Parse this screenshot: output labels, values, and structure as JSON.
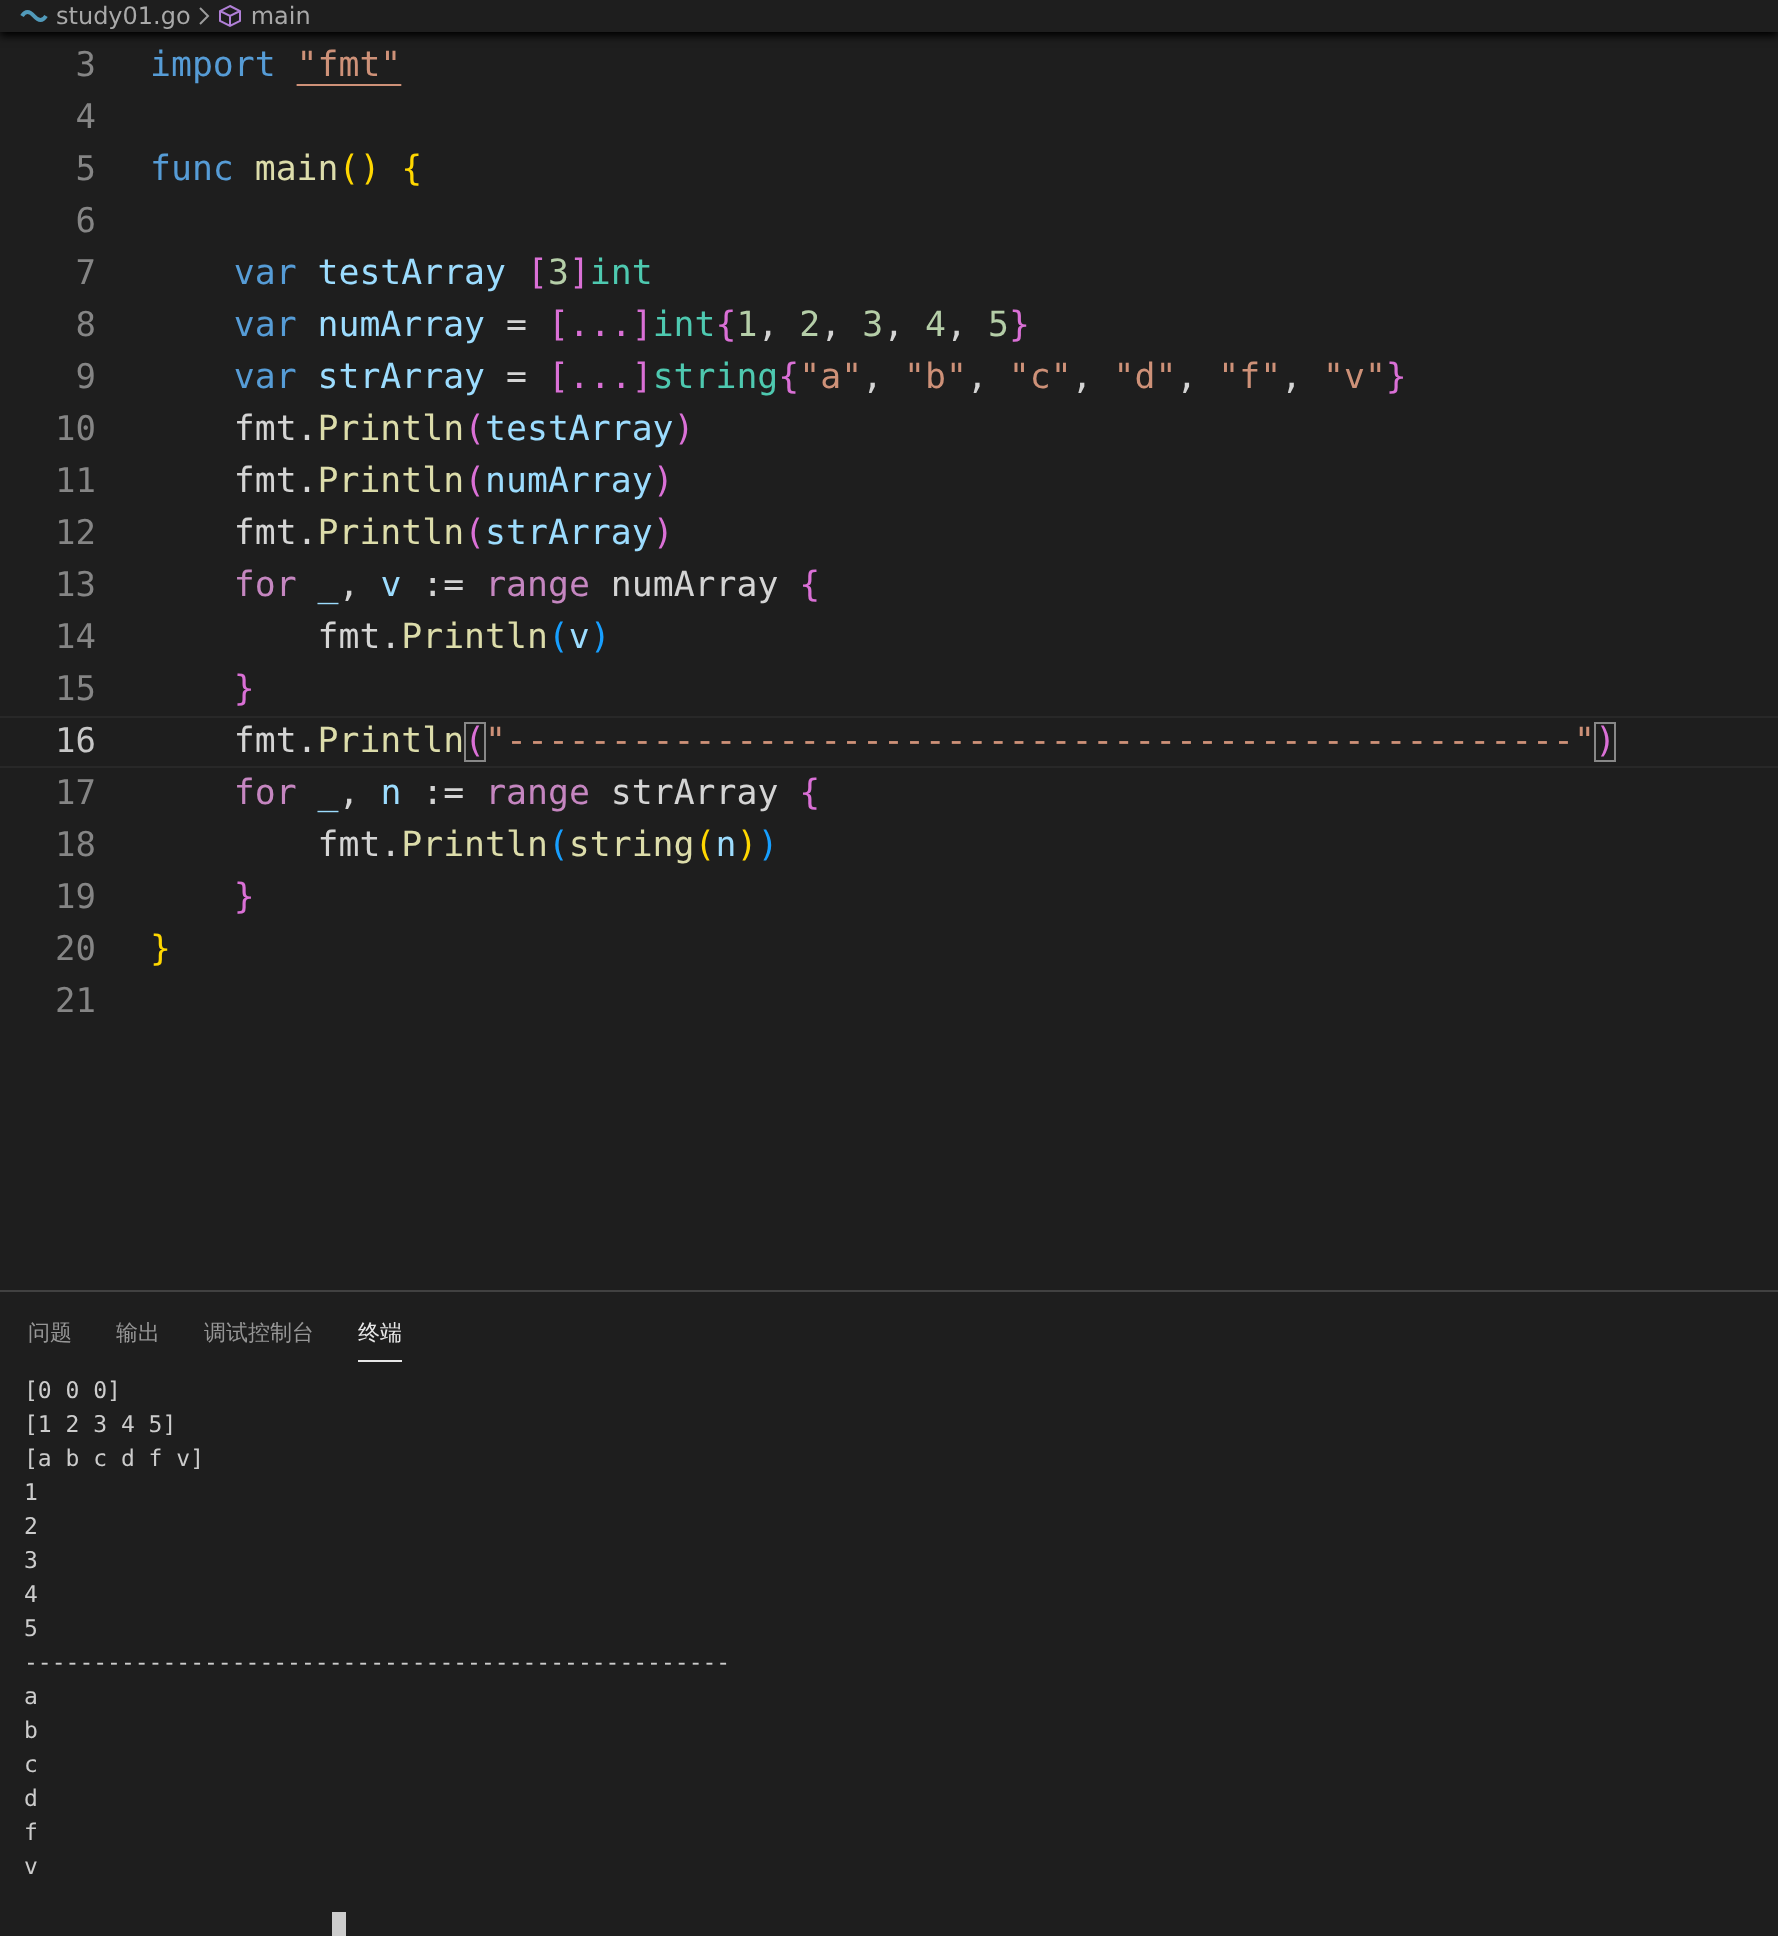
{
  "editor": {
    "breadcrumb": {
      "file": "study01.go",
      "symbol": "main"
    },
    "lines": [
      {
        "number": "3",
        "current": false,
        "tokens": [
          {
            "text": "import ",
            "kind": "keyword"
          },
          {
            "text": "\"fmt\"",
            "kind": "link-string"
          }
        ]
      },
      {
        "number": "4",
        "current": false
      },
      {
        "number": "5",
        "current": false,
        "tokens": [
          {
            "text": "func ",
            "kind": "keyword"
          },
          {
            "text": "main",
            "kind": "function"
          },
          {
            "text": "() {",
            "kind": "bracket1"
          }
        ]
      },
      {
        "number": "6",
        "current": false
      },
      {
        "number": "7",
        "current": false,
        "tokens": [
          {
            "text": "    var ",
            "kind": "keyword"
          },
          {
            "text": "testArray ",
            "kind": "variable"
          },
          {
            "text": "[",
            "kind": "bracket2"
          },
          {
            "text": "3",
            "kind": "number"
          },
          {
            "text": "]",
            "kind": "bracket2"
          },
          {
            "text": "int",
            "kind": "type"
          }
        ]
      },
      {
        "number": "8",
        "current": false,
        "tokens": [
          {
            "text": "    var ",
            "kind": "keyword"
          },
          {
            "text": "numArray",
            "kind": "variable"
          },
          {
            "text": " = ",
            "kind": "plain"
          },
          {
            "text": "[...]",
            "kind": "bracket2"
          },
          {
            "text": "int",
            "kind": "type"
          },
          {
            "text": "{",
            "kind": "bracket2"
          },
          {
            "text": "1",
            "kind": "number"
          },
          {
            "text": ", ",
            "kind": "plain"
          },
          {
            "text": "2",
            "kind": "number"
          },
          {
            "text": ", ",
            "kind": "plain"
          },
          {
            "text": "3",
            "kind": "number"
          },
          {
            "text": ", ",
            "kind": "plain"
          },
          {
            "text": "4",
            "kind": "number"
          },
          {
            "text": ", ",
            "kind": "plain"
          },
          {
            "text": "5",
            "kind": "number"
          },
          {
            "text": "}",
            "kind": "bracket2"
          }
        ]
      },
      {
        "number": "9",
        "current": false,
        "tokens": [
          {
            "text": "    var ",
            "kind": "keyword"
          },
          {
            "text": "strArray",
            "kind": "variable"
          },
          {
            "text": " = ",
            "kind": "plain"
          },
          {
            "text": "[...]",
            "kind": "bracket2"
          },
          {
            "text": "string",
            "kind": "type"
          },
          {
            "text": "{",
            "kind": "bracket2"
          },
          {
            "text": "\"a\"",
            "kind": "string"
          },
          {
            "text": ", ",
            "kind": "plain"
          },
          {
            "text": "\"b\"",
            "kind": "string"
          },
          {
            "text": ", ",
            "kind": "plain"
          },
          {
            "text": "\"c\"",
            "kind": "string"
          },
          {
            "text": ", ",
            "kind": "plain"
          },
          {
            "text": "\"d\"",
            "kind": "string"
          },
          {
            "text": ", ",
            "kind": "plain"
          },
          {
            "text": "\"f\"",
            "kind": "string"
          },
          {
            "text": ", ",
            "kind": "plain"
          },
          {
            "text": "\"v\"",
            "kind": "string"
          },
          {
            "text": "}",
            "kind": "bracket2"
          }
        ]
      },
      {
        "number": "10",
        "current": false,
        "tokens": [
          {
            "text": "    fmt.",
            "kind": "plain"
          },
          {
            "text": "Println",
            "kind": "function"
          },
          {
            "text": "(",
            "kind": "bracket2"
          },
          {
            "text": "testArray",
            "kind": "variable"
          },
          {
            "text": ")",
            "kind": "bracket2"
          }
        ]
      },
      {
        "number": "11",
        "current": false,
        "tokens": [
          {
            "text": "    fmt.",
            "kind": "plain"
          },
          {
            "text": "Println",
            "kind": "function"
          },
          {
            "text": "(",
            "kind": "bracket2"
          },
          {
            "text": "numArray",
            "kind": "variable"
          },
          {
            "text": ")",
            "kind": "bracket2"
          }
        ]
      },
      {
        "number": "12",
        "current": false,
        "tokens": [
          {
            "text": "    fmt.",
            "kind": "plain"
          },
          {
            "text": "Println",
            "kind": "function"
          },
          {
            "text": "(",
            "kind": "bracket2"
          },
          {
            "text": "strArray",
            "kind": "variable"
          },
          {
            "text": ")",
            "kind": "bracket2"
          }
        ]
      },
      {
        "number": "13",
        "current": false,
        "tokens": [
          {
            "text": "    for ",
            "kind": "control"
          },
          {
            "text": "_",
            "kind": "variable"
          },
          {
            "text": ", ",
            "kind": "plain"
          },
          {
            "text": "v",
            "kind": "variable"
          },
          {
            "text": " := ",
            "kind": "plain"
          },
          {
            "text": "range",
            "kind": "control"
          },
          {
            "text": " numArray ",
            "kind": "plain"
          },
          {
            "text": "{",
            "kind": "bracket2"
          }
        ]
      },
      {
        "number": "14",
        "current": false,
        "tokens": [
          {
            "text": "        fmt.",
            "kind": "plain"
          },
          {
            "text": "Println",
            "kind": "function"
          },
          {
            "text": "(",
            "kind": "bracket3"
          },
          {
            "text": "v",
            "kind": "variable"
          },
          {
            "text": ")",
            "kind": "bracket3"
          }
        ]
      },
      {
        "number": "15",
        "current": false,
        "tokens": [
          {
            "text": "    }",
            "kind": "bracket2"
          }
        ]
      },
      {
        "number": "16",
        "current": true,
        "tokens": [
          {
            "text": "    fmt.",
            "kind": "plain"
          },
          {
            "text": "Println",
            "kind": "function"
          },
          {
            "text": "(",
            "kind": "bracket-match"
          },
          {
            "text": "\"---------------------------------------------------\"",
            "kind": "string"
          },
          {
            "text": ")",
            "kind": "bracket-match"
          }
        ]
      },
      {
        "number": "17",
        "current": false,
        "tokens": [
          {
            "text": "    for ",
            "kind": "control"
          },
          {
            "text": "_",
            "kind": "variable"
          },
          {
            "text": ", ",
            "kind": "plain"
          },
          {
            "text": "n",
            "kind": "variable"
          },
          {
            "text": " := ",
            "kind": "plain"
          },
          {
            "text": "range",
            "kind": "control"
          },
          {
            "text": " strArray ",
            "kind": "plain"
          },
          {
            "text": "{",
            "kind": "bracket2"
          }
        ]
      },
      {
        "number": "18",
        "current": false,
        "tokens": [
          {
            "text": "        fmt.",
            "kind": "plain"
          },
          {
            "text": "Println",
            "kind": "function"
          },
          {
            "text": "(",
            "kind": "bracket3"
          },
          {
            "text": "string",
            "kind": "function"
          },
          {
            "text": "(",
            "kind": "bracket1"
          },
          {
            "text": "n",
            "kind": "variable"
          },
          {
            "text": ")",
            "kind": "bracket1"
          },
          {
            "text": ")",
            "kind": "bracket3"
          }
        ]
      },
      {
        "number": "19",
        "current": false,
        "tokens": [
          {
            "text": "    }",
            "kind": "bracket2"
          }
        ]
      },
      {
        "number": "20",
        "current": false,
        "tokens": [
          {
            "text": "}",
            "kind": "bracket1"
          }
        ]
      },
      {
        "number": "21",
        "current": false
      }
    ]
  },
  "panel": {
    "tabs": [
      {
        "label": "问题",
        "selected": false
      },
      {
        "label": "输出",
        "selected": false
      },
      {
        "label": "调试控制台",
        "selected": false
      },
      {
        "label": "终端",
        "selected": true
      }
    ],
    "terminal_lines": [
      "[0 0 0]",
      "[1 2 3 4 5]",
      "[a b c d f v]",
      "1",
      "2",
      "3",
      "4",
      "5",
      "---------------------------------------------------",
      "a",
      "b",
      "c",
      "d",
      "f",
      "v"
    ]
  }
}
